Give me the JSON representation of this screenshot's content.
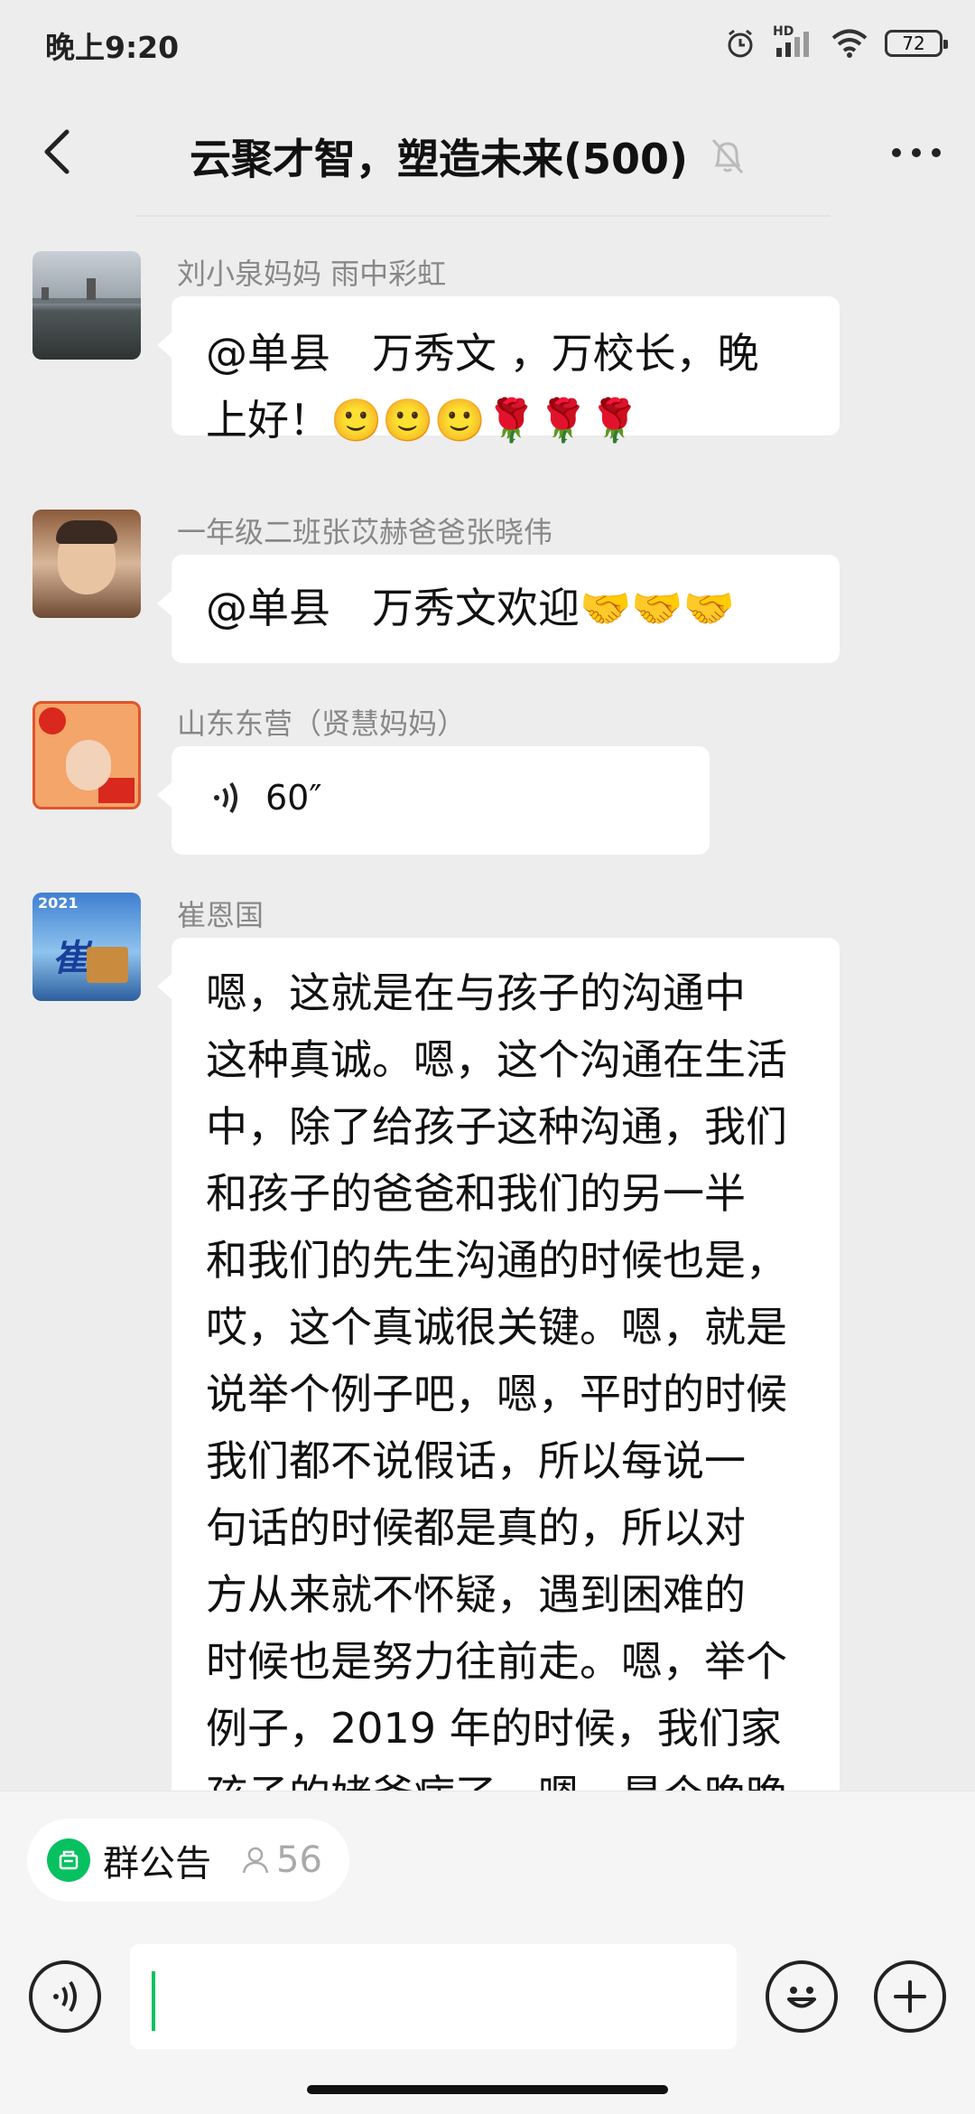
{
  "status": {
    "time": "晚上9:20",
    "battery": "72",
    "hd": "HD"
  },
  "header": {
    "title": "云聚才智，塑造未来(500)"
  },
  "messages": [
    {
      "sender": "刘小泉妈妈  雨中彩虹",
      "lines": [
        "@单县　万秀文 ，万校长，晚",
        "上好！🙂🙂🙂🌹🌹🌹"
      ]
    },
    {
      "sender": "一年级二班张苡赫爸爸张晓伟",
      "lines": [
        "@单县　万秀文欢迎🤝🤝🤝"
      ]
    },
    {
      "sender": "山东东营（贤慧妈妈）",
      "voice_duration": "60″"
    },
    {
      "sender": "崔恩国",
      "avatar_text": "崔",
      "avatar_banner": "2021",
      "lines": [
        "嗯，这就是在与孩子的沟通中",
        "这种真诚。嗯，这个沟通在生活",
        "中，除了给孩子这种沟通，我们",
        "和孩子的爸爸和我们的另一半",
        "和我们的先生沟通的时候也是，",
        "哎，这个真诚很关键。嗯，就是",
        "说举个例子吧，嗯，平时的时候",
        "我们都不说假话，所以每说一",
        "句话的时候都是真的，所以对",
        "方从来就不怀疑，遇到困难的",
        "时候也是努力往前走。嗯，举个",
        "例子，2019 年的时候，我们家",
        "孩子的姥爷病了，嗯，是个晚晚"
      ]
    }
  ],
  "notice": {
    "label": "群公告",
    "count": "56"
  },
  "colors": {
    "accent": "#07c160",
    "background": "#ededed",
    "bubble": "#ffffff"
  }
}
